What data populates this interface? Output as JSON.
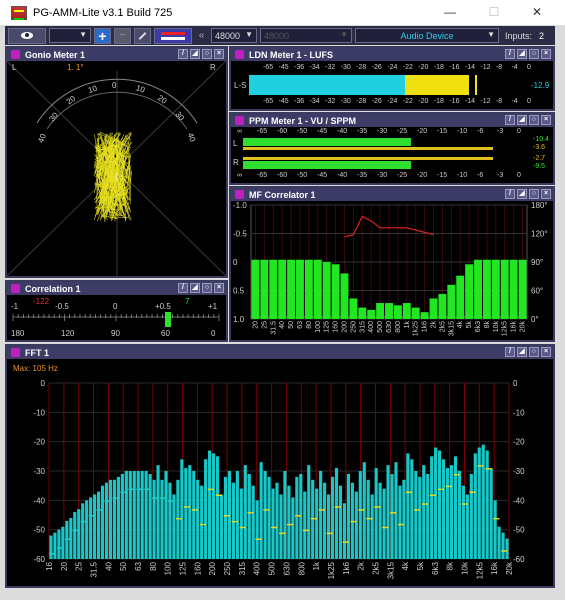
{
  "window": {
    "title": "PG-AMM-Lite v3.1 Build 725",
    "min": "—",
    "max": "☐",
    "close": "✕"
  },
  "toolbar": {
    "samplerate": "48000",
    "disabled_combo": "48000",
    "device": "Audio Device",
    "inputs_label": "Inputs:",
    "inputs_value": "2",
    "chevron": "«",
    "plus": "+",
    "minus": "−"
  },
  "panels": {
    "gonio": {
      "title": "Gonio Meter 1",
      "left": "L",
      "right": "R",
      "reading": "1. 1°",
      "scale": [
        "40",
        "30",
        "20",
        "10",
        "0",
        "10",
        "20",
        "30",
        "40"
      ]
    },
    "ldn": {
      "title": "LDN Meter 1 - LUFS",
      "ticks": [
        "-65",
        "-45",
        "-36",
        "-34",
        "-32",
        "-30",
        "-28",
        "-26",
        "-24",
        "-22",
        "-20",
        "-18",
        "-16",
        "-14",
        "-12",
        "-8",
        "-4",
        "0"
      ],
      "channel": "L-S",
      "value": "-12.9"
    },
    "ppm": {
      "title": "PPM Meter 1 - VU / SPPM",
      "ticks_top": [
        "∞",
        "-65",
        "-60",
        "-50",
        "-45",
        "-40",
        "-35",
        "-30",
        "-25",
        "-20",
        "-15",
        "-10",
        "-6",
        "-3",
        "0"
      ],
      "ticks_bottom": [
        "∞",
        "-65",
        "-60",
        "-50",
        "-45",
        "-40",
        "-35",
        "-30",
        "-25",
        "-20",
        "-15",
        "-10",
        "-6",
        "-3",
        "0"
      ],
      "ch_l": "L",
      "ch_r": "R",
      "val_l_a": "-10.4",
      "val_l_b": "-3.6",
      "val_r_a": "-2.7",
      "val_r_b": "-9.5"
    },
    "correlation": {
      "title": "Correlation 1",
      "top_scale": [
        "-1",
        "-0.5",
        "0",
        "+0.5",
        "+1"
      ],
      "bottom_scale": [
        "180",
        "120",
        "90",
        "60",
        "0"
      ],
      "left_val": "-122",
      "right_val": "7"
    },
    "mf": {
      "title": "MF Correlator 1",
      "left_axis": [
        "-1.0",
        "-0.5",
        "0",
        "0.5",
        "1.0"
      ],
      "right_axis": [
        "180°",
        "120°",
        "90°",
        "60°",
        "0°"
      ],
      "freqs": [
        "20",
        "25",
        "31.5",
        "40",
        "50",
        "63",
        "80",
        "100",
        "125",
        "160",
        "200",
        "250",
        "315",
        "400",
        "500",
        "630",
        "800",
        "1k",
        "1k25",
        "1k6",
        "2k",
        "2k5",
        "3k15",
        "4k",
        "5k",
        "6k3",
        "8k",
        "10k",
        "12k5",
        "16k",
        "20k"
      ],
      "bars": [
        0.52,
        0.52,
        0.52,
        0.52,
        0.52,
        0.52,
        0.52,
        0.52,
        0.5,
        0.48,
        0.4,
        0.18,
        0.1,
        0.08,
        0.14,
        0.14,
        0.12,
        0.14,
        0.1,
        0.06,
        0.18,
        0.22,
        0.3,
        0.38,
        0.48,
        0.52,
        0.52,
        0.52,
        0.52,
        0.52,
        0.52
      ],
      "red": [
        null,
        null,
        null,
        null,
        null,
        null,
        null,
        null,
        null,
        null,
        0.72,
        0.74,
        0.9,
        0.86,
        0.8,
        0.8,
        0.8,
        0.8,
        0.78,
        0.76,
        0.74,
        null,
        null,
        null,
        null,
        null,
        null,
        null,
        null,
        null,
        null
      ],
      "colors": {
        "bar": "#22e622",
        "red": "#e42020",
        "grid": "#3a0a0a"
      }
    },
    "fft": {
      "title": "FFT 1",
      "max_label": "Max: 105 Hz",
      "yaxis": [
        "0",
        "-10",
        "-20",
        "-30",
        "-40",
        "-50",
        "-60"
      ],
      "freqs": [
        "16",
        "20",
        "25",
        "31.5",
        "40",
        "50",
        "63",
        "80",
        "100",
        "125",
        "160",
        "200",
        "250",
        "315",
        "400",
        "500",
        "630",
        "800",
        "1k",
        "1k25",
        "1k6",
        "2k",
        "2k5",
        "3k15",
        "4k",
        "5k",
        "6k3",
        "8k",
        "10k",
        "12k5",
        "16k",
        "20k"
      ],
      "bars": [
        -52,
        -51,
        -50,
        -49,
        -47,
        -46,
        -44,
        -43,
        -41,
        -40,
        -39,
        -38,
        -37,
        -35,
        -34,
        -33,
        -33,
        -32,
        -31,
        -30,
        -30,
        -30,
        -30,
        -30,
        -30,
        -31,
        -33,
        -28,
        -33,
        -30,
        -34,
        -38,
        -33,
        -26,
        -29,
        -28,
        -30,
        -33,
        -35,
        -26,
        -23,
        -24,
        -25,
        -38,
        -32,
        -30,
        -34,
        -30,
        -36,
        -28,
        -31,
        -35,
        -40,
        -27,
        -30,
        -32,
        -36,
        -34,
        -38,
        -30,
        -35,
        -39,
        -32,
        -31,
        -37,
        -28,
        -33,
        -36,
        -30,
        -34,
        -38,
        -32,
        -29,
        -35,
        -41,
        -31,
        -34,
        -37,
        -30,
        -27,
        -33,
        -38,
        -29,
        -34,
        -36,
        -28,
        -31,
        -27,
        -35,
        -33,
        -24,
        -26,
        -30,
        -32,
        -28,
        -31,
        -25,
        -22,
        -23,
        -26,
        -29,
        -28,
        -25,
        -30,
        -35,
        -38,
        -31,
        -24,
        -22,
        -21,
        -23,
        -29,
        -40,
        -49,
        -51,
        -53
      ],
      "colors": {
        "bar": "#18c8c8",
        "peak": "#e8d820",
        "cyan_dot": "#20d0d0",
        "grid": "#7a0000"
      }
    }
  }
}
